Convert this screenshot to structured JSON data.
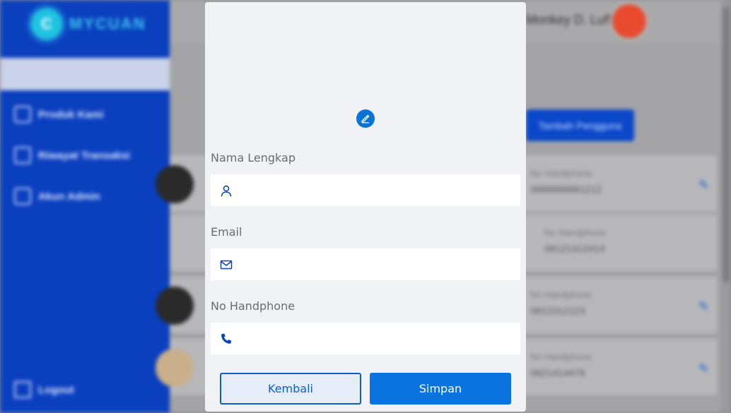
{
  "background": {
    "app_name": "MYCUAN",
    "user_name": "Monkey D. Luffy",
    "sidebar": {
      "items": [
        {
          "label": "Produk Kami"
        },
        {
          "label": "Riwayat Transaksi"
        },
        {
          "label": "Akun Admin"
        }
      ],
      "logout_label": "Logout"
    },
    "add_button_label": "Tambah Pengguna",
    "rows": [
      {
        "label": "No Handphone",
        "value": "0888888881212"
      },
      {
        "label": "No Handphone",
        "value": "08121412414"
      },
      {
        "label": "No Handphone",
        "value": "0812312123"
      },
      {
        "label": "No Handphone",
        "value": "0821414478"
      }
    ]
  },
  "modal": {
    "fields": [
      {
        "label": "Nama Lengkap",
        "value": "",
        "placeholder": "",
        "icon": "user-icon"
      },
      {
        "label": "Email",
        "value": "",
        "placeholder": "",
        "icon": "mail-icon"
      },
      {
        "label": "No Handphone",
        "value": "",
        "placeholder": "",
        "icon": "phone-icon"
      }
    ],
    "back_label": "Kembali",
    "save_label": "Simpan"
  },
  "colors": {
    "primary": "#0a73e0",
    "sidebar": "#0a3fbe",
    "modal_bg": "#f1f2f5"
  }
}
